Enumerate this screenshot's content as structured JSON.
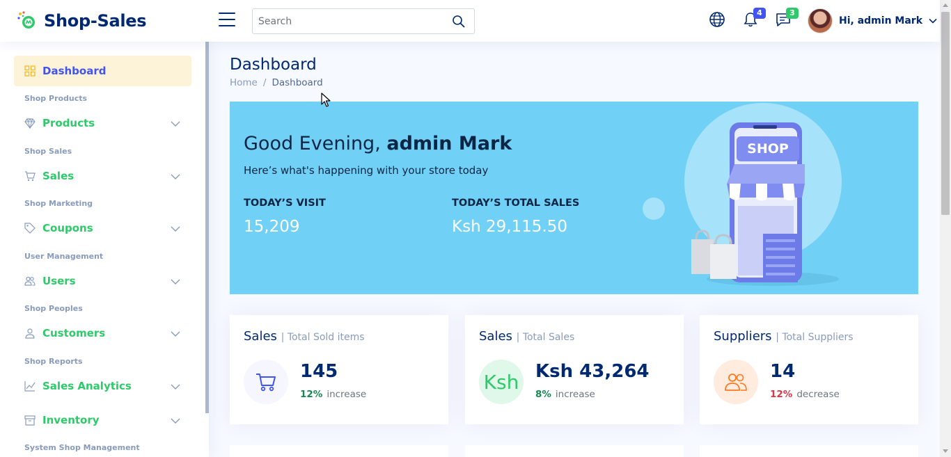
{
  "brand": {
    "name": "Shop-Sales"
  },
  "search": {
    "placeholder": "Search"
  },
  "header": {
    "notifications_count": "4",
    "messages_count": "3",
    "user_greeting": "Hi, admin Mark",
    "colors": {
      "notif_badge": "#4154f1",
      "msg_badge": "#2eca6a"
    }
  },
  "sidebar": {
    "active": {
      "label": "Dashboard",
      "icon": "grid-icon"
    },
    "sections": [
      {
        "heading": "Shop Products",
        "label": "Products",
        "icon": "gem-icon"
      },
      {
        "heading": "Shop Sales",
        "label": "Sales",
        "icon": "cart-icon"
      },
      {
        "heading": "Shop Marketing",
        "label": "Coupons",
        "icon": "tag-icon"
      },
      {
        "heading": "User Management",
        "label": "Users",
        "icon": "users-icon"
      },
      {
        "heading": "Shop Peoples",
        "label": "Customers",
        "icon": "person-icon"
      },
      {
        "heading": "Shop Reports",
        "label": "Sales Analytics",
        "icon": "chart-icon"
      },
      {
        "heading": "",
        "label": "Inventory",
        "icon": "archive-icon"
      }
    ],
    "last_heading": "System Shop Management"
  },
  "page": {
    "title": "Dashboard",
    "breadcrumb": {
      "home": "Home",
      "sep": "/",
      "current": "Dashboard"
    }
  },
  "banner": {
    "greeting_prefix": "Good Evening,",
    "greeting_name": "admin Mark",
    "subtitle": "Here’s what's happening with your store today",
    "visit_label": "TODAY’S VISIT",
    "visit_value": "15,209",
    "sales_label": "TODAY’S TOTAL SALES",
    "sales_value": "Ksh 29,115.50",
    "illustration_text": "SHOP",
    "color": "#70d0f5"
  },
  "cards": [
    {
      "title": "Sales",
      "sub": "| Total Sold items",
      "value": "145",
      "pct": "12%",
      "word": "increase",
      "trend": "up",
      "icon": "cart-icon"
    },
    {
      "title": "Sales",
      "sub": "| Total Sales",
      "value": "Ksh 43,264",
      "pct": "8%",
      "word": "increase",
      "trend": "up",
      "icon": "Ksh"
    },
    {
      "title": "Suppliers",
      "sub": "| Total Suppliers",
      "value": "14",
      "pct": "12%",
      "word": "decrease",
      "trend": "down",
      "icon": "users-icon"
    }
  ]
}
